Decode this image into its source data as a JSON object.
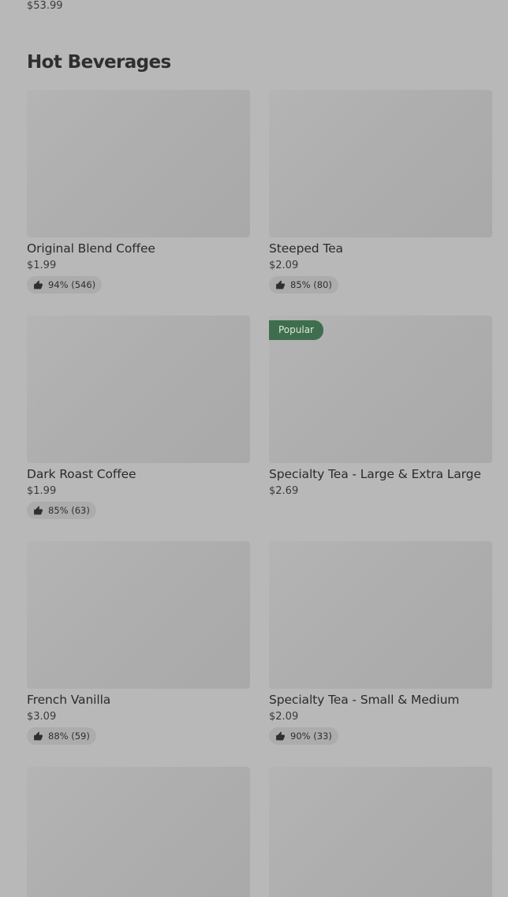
{
  "previous_section": {
    "last_price": "$53.99"
  },
  "section": {
    "title": "Hot Beverages"
  },
  "items": [
    {
      "name": "Original Blend Coffee",
      "price": "$1.99",
      "rating": "94% (546)",
      "badge": ""
    },
    {
      "name": "Steeped Tea",
      "price": "$2.09",
      "rating": "85% (80)",
      "badge": ""
    },
    {
      "name": "Dark Roast Coffee",
      "price": "$1.99",
      "rating": "85% (63)",
      "badge": ""
    },
    {
      "name": "Specialty Tea - Large & Extra Large",
      "price": "$2.69",
      "rating": "",
      "badge": "Popular"
    },
    {
      "name": "French Vanilla",
      "price": "$3.09",
      "rating": "88% (59)",
      "badge": ""
    },
    {
      "name": "Specialty Tea - Small & Medium",
      "price": "$2.09",
      "rating": "90% (33)",
      "badge": ""
    },
    {
      "name": "",
      "price": "",
      "rating": "",
      "badge": ""
    },
    {
      "name": "",
      "price": "",
      "rating": "",
      "badge": ""
    }
  ],
  "icons": {
    "rating": "thumbs-up-icon"
  },
  "colors": {
    "badge_bg": "#3f6e4e",
    "background": "#b8b8b8"
  }
}
